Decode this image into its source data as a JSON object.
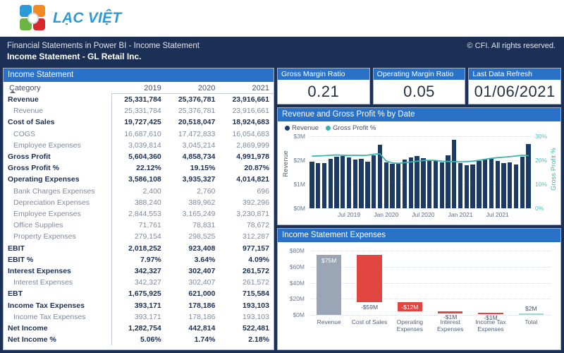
{
  "brand": {
    "name": "LẠC VIỆT"
  },
  "header": {
    "subtitle": "Financial Statements in Power BI - Income Statement",
    "title": "Income Statement - GL Retail Inc.",
    "copyright": "© CFI. All rights reserved."
  },
  "income_statement": {
    "panel_title": "Income Statement",
    "columns": [
      "Category",
      "2019",
      "2020",
      "2021"
    ],
    "rows": [
      {
        "label": "Revenue",
        "level": 0,
        "values": [
          "25,331,784",
          "25,376,781",
          "23,916,661"
        ]
      },
      {
        "label": "Revenue",
        "level": 1,
        "values": [
          "25,331,784",
          "25,376,781",
          "23,916,661"
        ]
      },
      {
        "label": "Cost of Sales",
        "level": 0,
        "values": [
          "19,727,425",
          "20,518,047",
          "18,924,683"
        ]
      },
      {
        "label": "COGS",
        "level": 1,
        "values": [
          "16,687,610",
          "17,472,833",
          "16,054,683"
        ]
      },
      {
        "label": "Employee Expenses",
        "level": 1,
        "values": [
          "3,039,814",
          "3,045,214",
          "2,869,999"
        ]
      },
      {
        "label": "Gross Profit",
        "level": 0,
        "values": [
          "5,604,360",
          "4,858,734",
          "4,991,978"
        ]
      },
      {
        "label": "Gross Profit %",
        "level": 0,
        "values": [
          "22.12%",
          "19.15%",
          "20.87%"
        ]
      },
      {
        "label": "Operating Expenses",
        "level": 0,
        "values": [
          "3,586,108",
          "3,935,327",
          "4,014,821"
        ]
      },
      {
        "label": "Bank Charges Expenses",
        "level": 1,
        "values": [
          "2,400",
          "2,760",
          "696"
        ]
      },
      {
        "label": "Depreciation Expenses",
        "level": 1,
        "values": [
          "388,240",
          "389,962",
          "392,296"
        ]
      },
      {
        "label": "Employee Expenses",
        "level": 1,
        "values": [
          "2,844,553",
          "3,165,249",
          "3,230,871"
        ]
      },
      {
        "label": "Office Supplies",
        "level": 1,
        "values": [
          "71,761",
          "78,831",
          "78,672"
        ]
      },
      {
        "label": "Property Expenses",
        "level": 1,
        "values": [
          "279,154",
          "298,525",
          "312,287"
        ]
      },
      {
        "label": "EBIT",
        "level": 0,
        "values": [
          "2,018,252",
          "923,408",
          "977,157"
        ]
      },
      {
        "label": "EBIT %",
        "level": 0,
        "values": [
          "7.97%",
          "3.64%",
          "4.09%"
        ]
      },
      {
        "label": "Interest Expenses",
        "level": 0,
        "values": [
          "342,327",
          "302,407",
          "261,572"
        ]
      },
      {
        "label": "Interest Expenses",
        "level": 1,
        "values": [
          "342,327",
          "302,407",
          "261,572"
        ]
      },
      {
        "label": "EBT",
        "level": 0,
        "values": [
          "1,675,925",
          "621,000",
          "715,584"
        ]
      },
      {
        "label": "Income Tax Expenses",
        "level": 0,
        "values": [
          "393,171",
          "178,186",
          "193,103"
        ]
      },
      {
        "label": "Income Tax Expenses",
        "level": 1,
        "values": [
          "393,171",
          "178,186",
          "193,103"
        ]
      },
      {
        "label": "Net Income",
        "level": 0,
        "values": [
          "1,282,754",
          "442,814",
          "522,481"
        ]
      },
      {
        "label": "Net Income %",
        "level": 0,
        "values": [
          "5.06%",
          "1.74%",
          "2.18%"
        ]
      }
    ]
  },
  "kpis": [
    {
      "title": "Gross Margin Ratio",
      "value": "0.21"
    },
    {
      "title": "Operating Margin Ratio",
      "value": "0.05"
    },
    {
      "title": "Last Data Refresh",
      "value": "01/06/2021"
    }
  ],
  "colors": {
    "header_navy": "#1b3054",
    "panel_blue": "#2a72c8",
    "bar_navy": "#1b3a64",
    "line_teal": "#3bb3ac",
    "waterfall_gray": "#9aa6b6",
    "waterfall_red": "#e0453f",
    "waterfall_total": "#a8d5d2"
  },
  "chart_data": [
    {
      "type": "bar",
      "title": "Revenue and Gross Profit % by Date",
      "xlabel": "",
      "ylabel": "Revenue",
      "y2label": "Gross Profit %",
      "ylim": [
        0,
        3000000
      ],
      "y2lim": [
        0,
        0.3
      ],
      "yticks": [
        "$0M",
        "$1M",
        "$2M",
        "$3M"
      ],
      "y2ticks": [
        "0%",
        "10%",
        "20%",
        "30%"
      ],
      "grid": true,
      "legend": [
        "Revenue",
        "Gross Profit %"
      ],
      "legend_position": "top-left",
      "xticks": [
        "Jul 2019",
        "Jan 2020",
        "Jul 2020",
        "Jan 2021",
        "Jul 2021"
      ],
      "xtick_index": [
        6,
        12,
        18,
        24,
        30
      ],
      "categories": [
        "Jan 2019",
        "Feb 2019",
        "Mar 2019",
        "Apr 2019",
        "May 2019",
        "Jun 2019",
        "Jul 2019",
        "Aug 2019",
        "Sep 2019",
        "Oct 2019",
        "Nov 2019",
        "Dec 2019",
        "Jan 2020",
        "Feb 2020",
        "Mar 2020",
        "Apr 2020",
        "May 2020",
        "Jun 2020",
        "Jul 2020",
        "Aug 2020",
        "Sep 2020",
        "Oct 2020",
        "Nov 2020",
        "Dec 2020",
        "Jan 2021",
        "Feb 2021",
        "Mar 2021",
        "Apr 2021",
        "May 2021",
        "Jun 2021",
        "Jul 2021",
        "Aug 2021",
        "Sep 2021",
        "Oct 2021",
        "Nov 2021",
        "Dec 2021"
      ],
      "series": [
        {
          "name": "Revenue",
          "axis": "left",
          "values": [
            1950000,
            1880000,
            1890000,
            2050000,
            2150000,
            2180000,
            2120000,
            2020000,
            2060000,
            1940000,
            2220000,
            2640000,
            1900000,
            1850000,
            1880000,
            2040000,
            2130000,
            2180000,
            2100000,
            1960000,
            2010000,
            1900000,
            2200000,
            2860000,
            1880000,
            1790000,
            1820000,
            1960000,
            2050000,
            2070000,
            1980000,
            1880000,
            1920000,
            1810000,
            2150000,
            2680000
          ]
        },
        {
          "name": "Gross Profit %",
          "axis": "right",
          "values": [
            0.217,
            0.218,
            0.219,
            0.221,
            0.222,
            0.221,
            0.22,
            0.221,
            0.22,
            0.221,
            0.225,
            0.227,
            0.197,
            0.189,
            0.187,
            0.19,
            0.193,
            0.196,
            0.199,
            0.2,
            0.199,
            0.196,
            0.195,
            0.194,
            0.193,
            0.194,
            0.196,
            0.2,
            0.204,
            0.208,
            0.211,
            0.213,
            0.215,
            0.218,
            0.221,
            0.219
          ]
        }
      ]
    },
    {
      "type": "bar",
      "title": "Income Statement Expenses",
      "subtype": "waterfall",
      "xlabel": "",
      "ylabel": "",
      "ylim": [
        0,
        80
      ],
      "yticks": [
        "$0M",
        "$20M",
        "$40M",
        "$60M",
        "$80M"
      ],
      "grid": true,
      "categories": [
        "Revenue",
        "Cost of Sales",
        "Operating Expenses",
        "Interest Expenses",
        "Income Tax Expenses",
        "Total"
      ],
      "values": [
        75,
        -59,
        -12,
        -1,
        -1,
        2
      ],
      "data_labels": [
        "$75M",
        "-$59M",
        "-$12M",
        "-$1M",
        "-$1M",
        "$2M"
      ],
      "bar_kinds": [
        "total",
        "negative",
        "negative",
        "negative",
        "negative",
        "total"
      ],
      "cumulative_start": [
        0,
        16,
        4,
        3,
        2,
        0
      ],
      "cumulative_end": [
        75,
        75,
        16,
        4,
        3,
        2
      ]
    }
  ]
}
